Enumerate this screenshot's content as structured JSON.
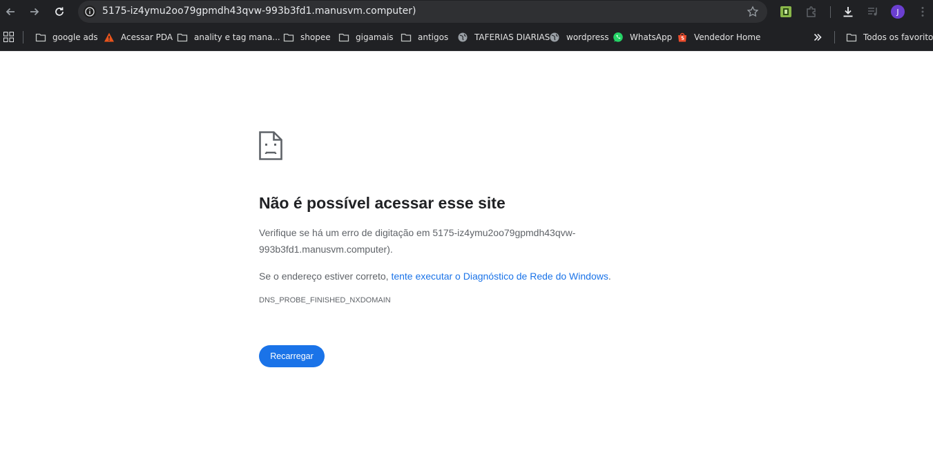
{
  "browser": {
    "url": "5175-iz4ymu2oo79gpmdh43qvw-993b3fd1.manusvm.computer)",
    "profile_initial": "J",
    "accent_color": "#1a73e8"
  },
  "bookmarks": [
    {
      "label": "google ads",
      "icon": "folder-icon"
    },
    {
      "label": "Acessar PDA",
      "icon": "warning-triangle-icon"
    },
    {
      "label": "anality e tag mana...",
      "icon": "folder-icon"
    },
    {
      "label": "shopee",
      "icon": "folder-icon"
    },
    {
      "label": "gigamais",
      "icon": "folder-icon"
    },
    {
      "label": "antigos",
      "icon": "folder-icon"
    },
    {
      "label": "TAFERIAS DIARIAS",
      "icon": "globe-icon"
    },
    {
      "label": "wordpress",
      "icon": "globe-icon"
    },
    {
      "label": "WhatsApp",
      "icon": "whatsapp-icon"
    },
    {
      "label": "Vendedor Home",
      "icon": "shopee-icon"
    }
  ],
  "all_bookmarks_label": "Todos os favoritos",
  "error": {
    "title": "Não é possível acessar esse site",
    "line1": "Verifique se há um erro de digitação em 5175-iz4ymu2oo79gpmdh43qvw-993b3fd1.manusvm.computer).",
    "line2_prefix": "Se o endereço estiver correto, ",
    "line2_link": "tente executar o Diagnóstico de Rede do Windows",
    "line2_suffix": ".",
    "code": "DNS_PROBE_FINISHED_NXDOMAIN",
    "reload_label": "Recarregar"
  }
}
